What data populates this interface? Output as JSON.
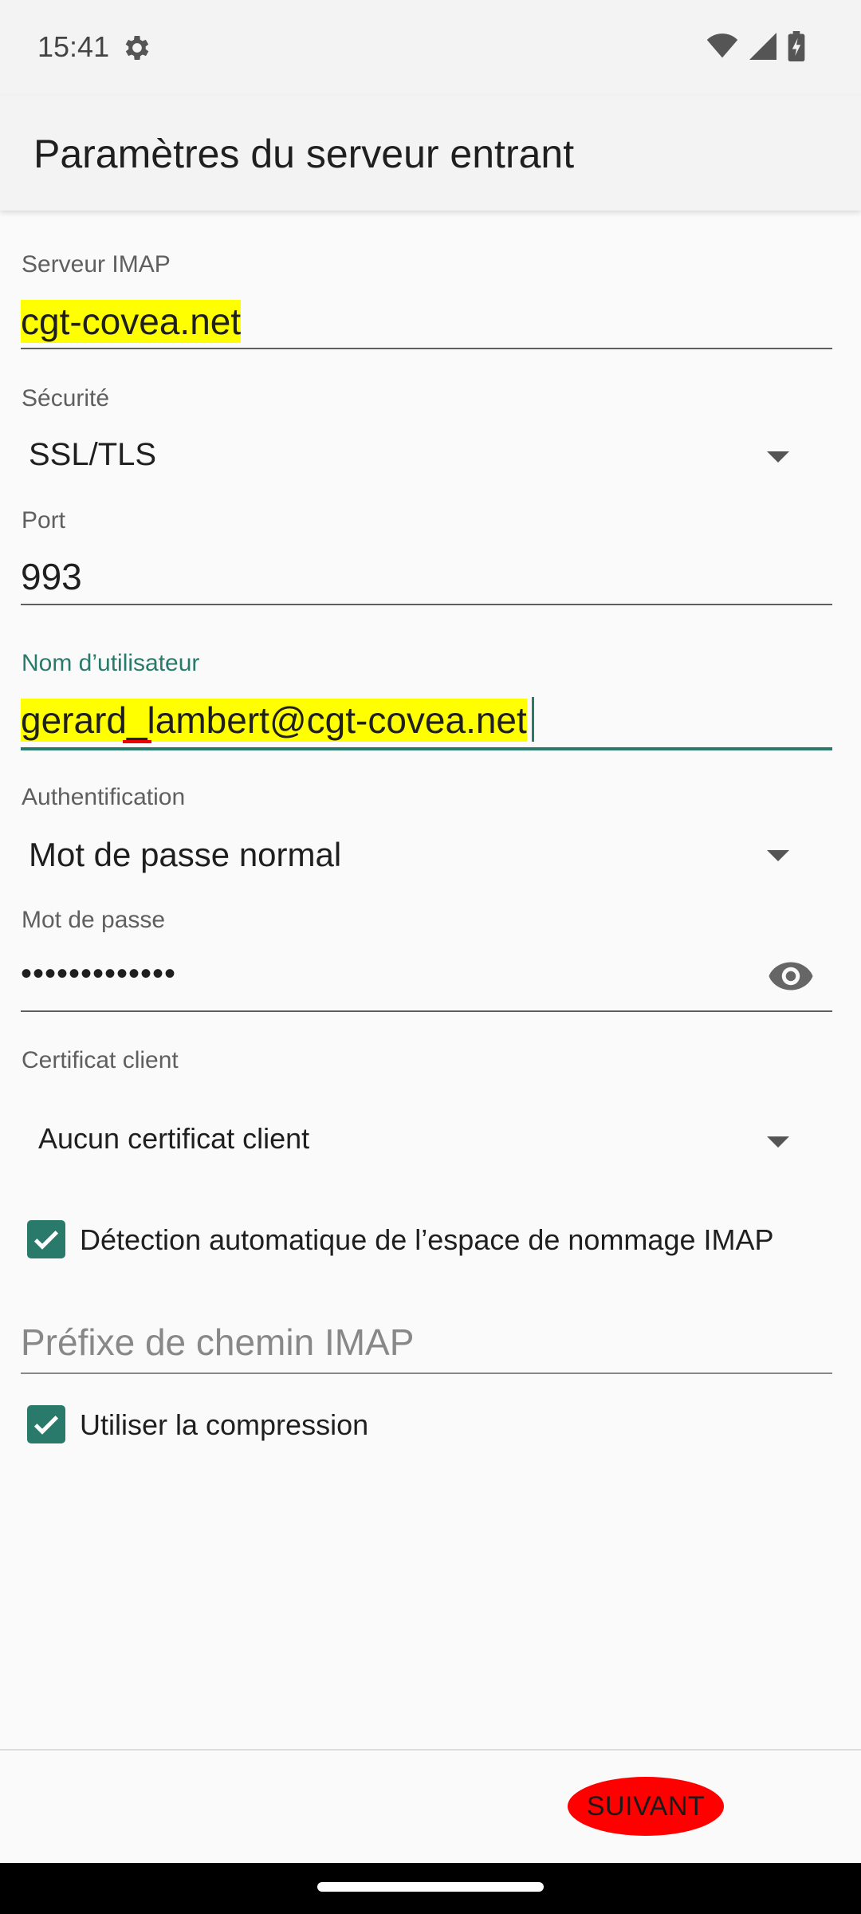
{
  "status_bar": {
    "time": "15:41",
    "icons": [
      "gear-icon",
      "wifi-icon",
      "cell-signal-icon",
      "battery-charging-icon"
    ]
  },
  "app_bar": {
    "title": "Paramètres du serveur entrant"
  },
  "form": {
    "imap_server": {
      "label": "Serveur IMAP",
      "value": "cgt-covea.net"
    },
    "security": {
      "label": "Sécurité",
      "value": "SSL/TLS"
    },
    "port": {
      "label": "Port",
      "value": "993"
    },
    "username": {
      "label": "Nom d’utilisateur",
      "value": "gerard_lambert@cgt-covea.net"
    },
    "authentication": {
      "label": "Authentification",
      "value": "Mot de passe normal"
    },
    "password": {
      "label": "Mot de passe",
      "value": "•••••••••••••"
    },
    "client_certificate": {
      "label": "Certificat client",
      "value": "Aucun certificat client"
    },
    "auto_namespace": {
      "label": "Détection automatique de l’espace de nommage IMAP",
      "checked": true
    },
    "path_prefix": {
      "placeholder": "Préfixe de chemin IMAP",
      "value": ""
    },
    "compression": {
      "label": "Utiliser la compression",
      "checked": true
    }
  },
  "footer": {
    "next_label": "SUIVANT"
  },
  "colors": {
    "accent": "#2a7a6c",
    "highlight": "#ffff00",
    "next_button": "#ff0000"
  }
}
